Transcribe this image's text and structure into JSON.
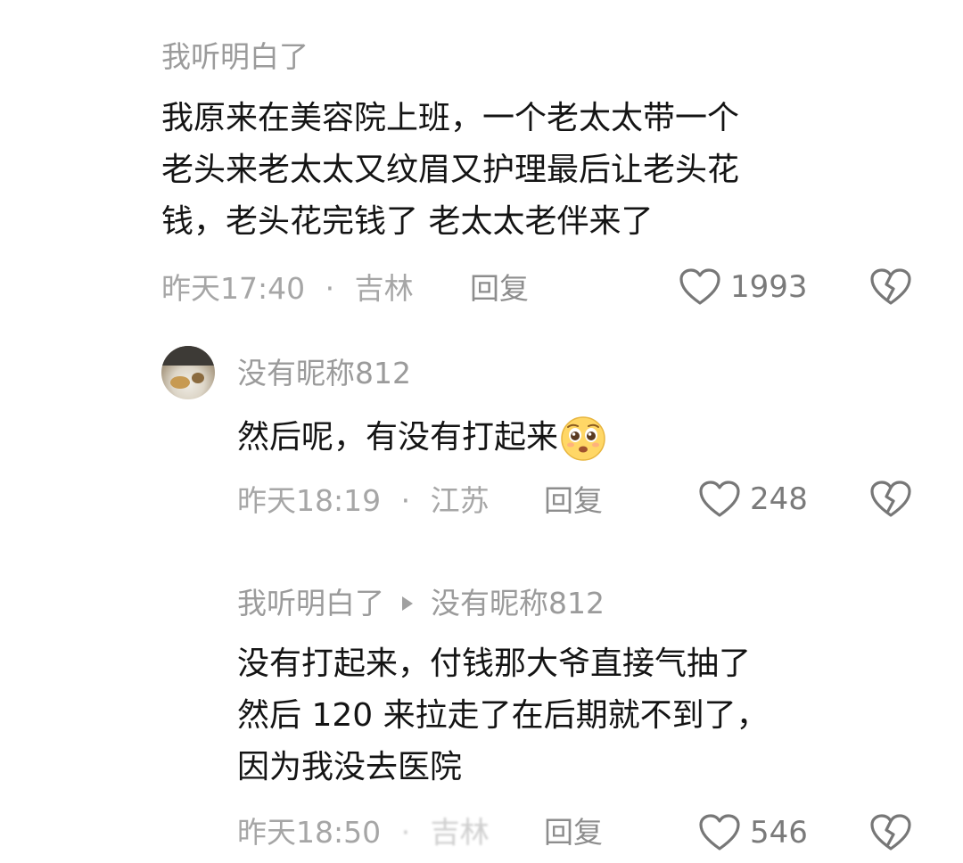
{
  "comments": [
    {
      "author": "我听明白了",
      "lines": [
        "我原来在美容院上班，一个老太太带一个",
        "老头来老太太又纹眉又护理最后让老头花",
        "钱，老头花完钱了 老太太老伴来了"
      ],
      "time": "昨天17:40",
      "location": "吉林",
      "reply_label": "回复",
      "likes": "1993"
    },
    {
      "author": "没有昵称812",
      "lines": [
        "然后呢，有没有打起来"
      ],
      "emoji": "pleading-face-emoji",
      "time": "昨天18:19",
      "location": "江苏",
      "reply_label": "回复",
      "likes": "248"
    },
    {
      "author": "我听明白了",
      "reply_to": "没有昵称812",
      "lines": [
        "没有打起来，付钱那大爷直接气抽了",
        "然后 120 来拉走了在后期就不到了，",
        "因为我没去医院"
      ],
      "time": "昨天18:50",
      "location": "吉林",
      "reply_label": "回复",
      "likes": "546"
    }
  ],
  "separator": "·",
  "icons": {
    "like": "heart-outline-icon",
    "dislike": "broken-heart-icon",
    "reply_arrow": "play-triangle-icon"
  },
  "colors": {
    "name": "#9b9b9b",
    "text": "#141414",
    "meta": "#a6a6a6",
    "icon": "#777777"
  }
}
